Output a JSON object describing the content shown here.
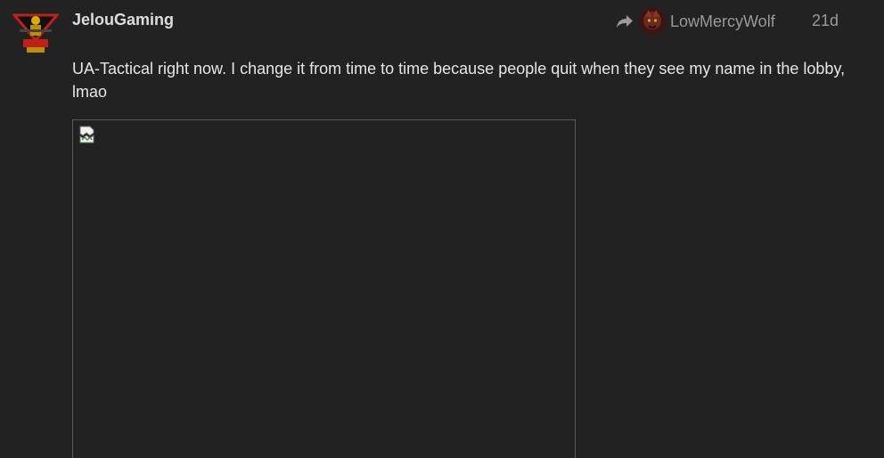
{
  "post": {
    "author": "JelouGaming",
    "avatar_icon": "squad-emblem-avatar",
    "reply_to": {
      "icon": "reply-arrow-icon",
      "user": "LowMercyWolf"
    },
    "date": "21d",
    "body": "UA-Tactical right now. I change it from time to time because people quit when they see my name in the lobby, lmao",
    "image": {
      "status": "broken",
      "icon": "broken-image-icon"
    }
  },
  "colors": {
    "background": "#222222",
    "username": "#dddddd",
    "meta": "#9a9a9a",
    "body_text": "#e6e6e6",
    "image_border": "#5b5b5b"
  }
}
